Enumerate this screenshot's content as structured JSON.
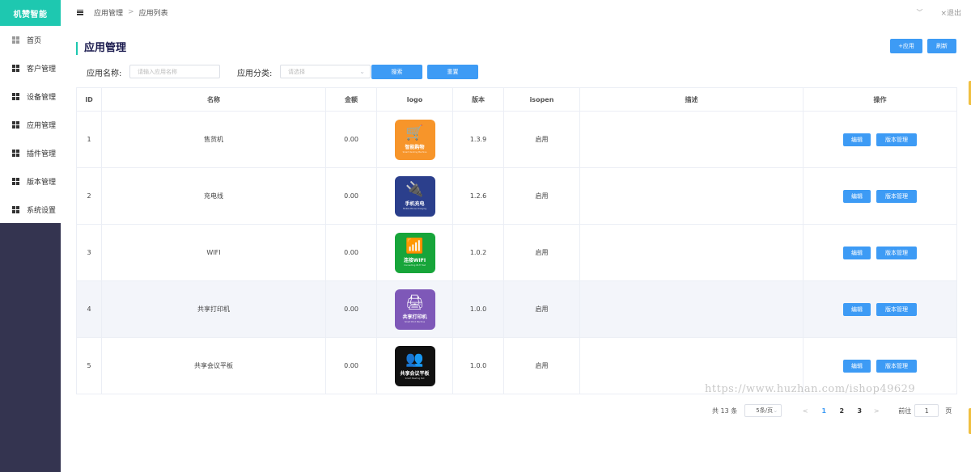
{
  "brand": "机赞智能",
  "sidebar": {
    "items": [
      {
        "label": "首页"
      },
      {
        "label": "客户管理"
      },
      {
        "label": "设备管理"
      },
      {
        "label": "应用管理"
      },
      {
        "label": "插件管理"
      },
      {
        "label": "版本管理"
      },
      {
        "label": "系统设置"
      }
    ]
  },
  "breadcrumb": {
    "level1": "应用管理",
    "separator": ">",
    "level2": "应用列表"
  },
  "topbar": {
    "logout": "×退出"
  },
  "page": {
    "title": "应用管理",
    "add_button": "+应用",
    "refresh_button": "刷新"
  },
  "filter": {
    "name_label": "应用名称:",
    "name_placeholder": "请输入应用名称",
    "category_label": "应用分类:",
    "category_placeholder": "请选择",
    "search_button": "搜索",
    "reset_button": "重置"
  },
  "table": {
    "columns": [
      "ID",
      "名称",
      "金额",
      "logo",
      "版本",
      "isopen",
      "描述",
      "操作"
    ],
    "edit_label": "编辑",
    "version_label": "版本管理",
    "rows": [
      {
        "id": "1",
        "name": "售货机",
        "amount": "0.00",
        "version": "1.3.9",
        "isopen": "启用",
        "desc": "",
        "logo": {
          "icon": "shopping-cart-icon",
          "color": "#f7952a",
          "name": "智能购物",
          "sub": "Smart Vending Machine",
          "glyph": "🛒"
        }
      },
      {
        "id": "2",
        "name": "充电线",
        "amount": "0.00",
        "version": "1.2.6",
        "isopen": "启用",
        "desc": "",
        "logo": {
          "icon": "charging-cable-icon",
          "color": "#2b3f8c",
          "name": "手机充电",
          "sub": "Mobile Phone Charging",
          "glyph": "🔌"
        }
      },
      {
        "id": "3",
        "name": "WIFI",
        "amount": "0.00",
        "version": "1.0.2",
        "isopen": "启用",
        "desc": "",
        "logo": {
          "icon": "wifi-icon",
          "color": "#17a53a",
          "name": "连接WIFI",
          "sub": "Connecting Wi-Fi Fast",
          "glyph": "📶"
        }
      },
      {
        "id": "4",
        "name": "共享打印机",
        "amount": "0.00",
        "version": "1.0.0",
        "isopen": "启用",
        "desc": "",
        "logo": {
          "icon": "printer-icon",
          "color": "#7e58b8",
          "name": "共享打印机",
          "sub": "Smart Print Machine",
          "glyph": "🖨"
        }
      },
      {
        "id": "5",
        "name": "共享会议平板",
        "amount": "0.00",
        "version": "1.0.0",
        "isopen": "启用",
        "desc": "",
        "logo": {
          "icon": "meeting-tablet-icon",
          "color": "#111111",
          "name": "共享会议平板",
          "sub": "Smart Meeting Pad",
          "glyph": "👥"
        }
      }
    ]
  },
  "pagination": {
    "total": "共 13 条",
    "page_size": "5条/页",
    "prev": "<",
    "pages": [
      "1",
      "2",
      "3"
    ],
    "current": "1",
    "next": ">",
    "goto_label": "前往",
    "goto_value": "1",
    "page_suffix": "页"
  },
  "watermark": "https://www.huzhan.com/ishop49629"
}
